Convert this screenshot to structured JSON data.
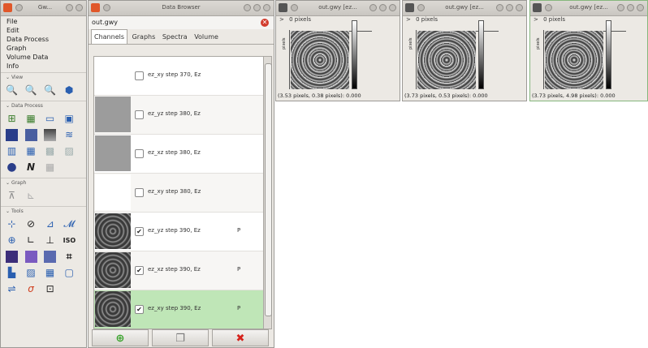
{
  "toolbox": {
    "title": "Gw...",
    "menu": [
      "File",
      "Edit",
      "Data Process",
      "Graph",
      "Volume Data",
      "Info"
    ],
    "sections": {
      "view": "View",
      "data_process": "Data Process",
      "graph": "Graph",
      "tools": "Tools"
    }
  },
  "browser": {
    "title": "Data Browser",
    "filename": "out.gwy",
    "tabs": [
      "Channels",
      "Graphs",
      "Spectra",
      "Volume"
    ],
    "rows": [
      {
        "label": "ez_xy step 370, Ez",
        "checked": false,
        "flag": ""
      },
      {
        "label": "ez_yz step 380, Ez",
        "checked": false,
        "flag": ""
      },
      {
        "label": "ez_xz step 380, Ez",
        "checked": false,
        "flag": ""
      },
      {
        "label": "ez_xy step 380, Ez",
        "checked": false,
        "flag": ""
      },
      {
        "label": "ez_yz step 390, Ez",
        "checked": true,
        "flag": "P"
      },
      {
        "label": "ez_xz step 390, Ez",
        "checked": true,
        "flag": "P"
      },
      {
        "label": "ez_xy step 390, Ez",
        "checked": true,
        "flag": "P"
      }
    ]
  },
  "windows": [
    {
      "title": "out.gwy [ez...",
      "ruler": "0 pixels",
      "axis": "pixels",
      "status": "(3.53 pixels, 0.38 pixels): 0.000"
    },
    {
      "title": "out.gwy [ez...",
      "ruler": "0 pixels",
      "axis": "pixels",
      "status": "(3.73 pixels, 0.53 pixels): 0.000"
    },
    {
      "title": "out.gwy [ez...",
      "ruler": "0 pixels",
      "axis": "pixels",
      "status": "(3.73 pixels, 4.98 pixels): 0.000"
    }
  ],
  "colors": {
    "selected_row": "#bfe6b7",
    "close": "#d23b2d",
    "add": "#3aa32c",
    "delete": "#d6231c"
  },
  "icons": {
    "add": "add-channel-icon",
    "duplicate": "duplicate-icon",
    "delete": "delete-icon"
  }
}
